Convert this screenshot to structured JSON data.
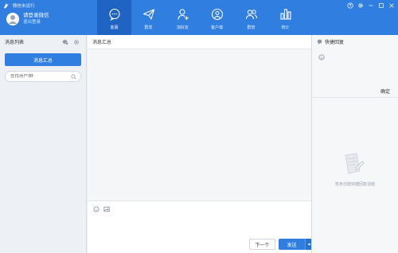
{
  "app": {
    "title": "微信未运行"
  },
  "profile": {
    "status": "请登录微信",
    "logout": "退出登录"
  },
  "nav": [
    {
      "label": "客服",
      "icon": "chat-icon",
      "active": true
    },
    {
      "label": "群发",
      "icon": "send-icon",
      "active": false
    },
    {
      "label": "加好友",
      "icon": "add-friend-icon",
      "active": false
    },
    {
      "label": "客户端",
      "icon": "client-icon",
      "active": false
    },
    {
      "label": "群管",
      "icon": "group-icon",
      "active": false
    },
    {
      "label": "统计",
      "icon": "stats-icon",
      "active": false
    }
  ],
  "sidebar": {
    "title": "消息列表",
    "button": "消息汇总",
    "search_placeholder": "查找用户/群"
  },
  "main": {
    "title": "消息汇总",
    "next_label": "下一个",
    "send_label": "发送"
  },
  "quick_reply": {
    "title": "快捷回复",
    "confirm": "确定",
    "empty_text": "暂未创建快捷回复话题"
  },
  "colors": {
    "accent": "#2f7ee0",
    "nav_active": "#1f64c2"
  }
}
